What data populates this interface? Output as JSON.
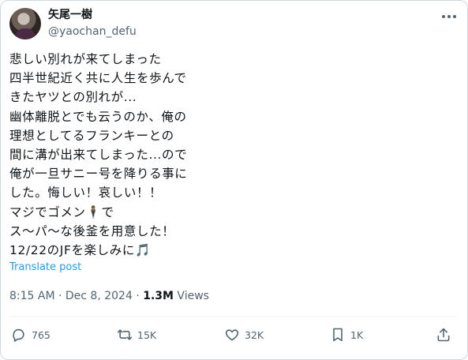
{
  "author": {
    "display_name": "矢尾一樹",
    "handle": "@yaochan_defu"
  },
  "post": {
    "lines": [
      "悲しい別れが来てしまった",
      "四半世紀近く共に人生を歩んで",
      "きたヤツとの別れが...",
      "幽体離脱とでも云うのか、俺の",
      "理想としてるフランキーとの",
      "間に溝が出来てしまった...ので",
      "俺が一旦サニー号を降りる事に",
      "した。悔しい！哀しい！！",
      "マジでゴメン🕴️で",
      "ス〜パ〜な後釜を用意した！",
      "12/22のJFを楽しみに🎵"
    ],
    "translate_label": "Translate post",
    "timestamp": "8:15 AM · Dec 8, 2024 · ",
    "views_count": "1.3M",
    "views_label": " Views"
  },
  "actions": {
    "replies": "765",
    "reposts": "15K",
    "likes": "32K",
    "bookmarks": "1K"
  },
  "icons": [
    "more-horizontal-icon",
    "reply-icon",
    "repost-icon",
    "like-icon",
    "bookmark-icon",
    "share-icon"
  ],
  "colors": {
    "text": "#0f1419",
    "secondary": "#536471",
    "link": "#1d9bf0",
    "divider": "#eff3f4"
  }
}
